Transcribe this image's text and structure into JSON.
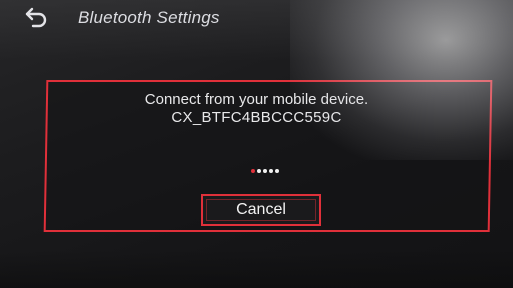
{
  "header": {
    "title": "Bluetooth Settings",
    "back_icon": "back-arrow-icon"
  },
  "dialog": {
    "message": "Connect from your mobile device.",
    "device_name": "CX_BTFC4BBCCC559C",
    "cancel_label": "Cancel",
    "spinner_icon": "loading-dots-icon"
  },
  "colors": {
    "accent": "#e0303a",
    "text": "#e8e8ea",
    "background": "#1c1c1e"
  }
}
